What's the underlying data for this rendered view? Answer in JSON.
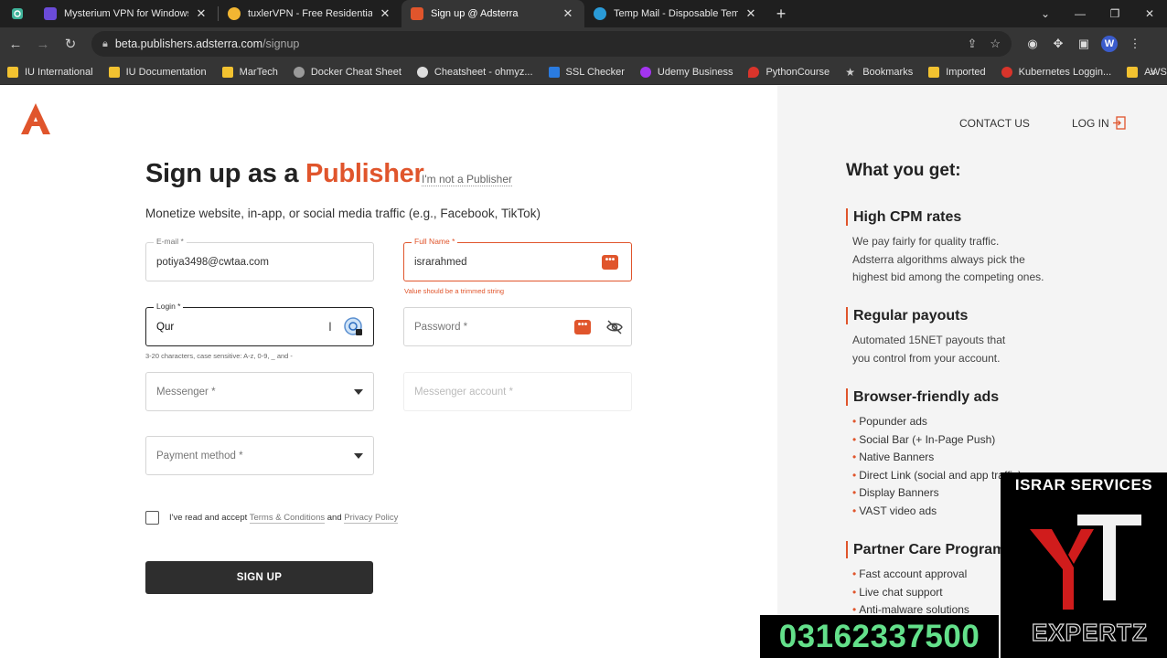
{
  "browser": {
    "tabs": [
      {
        "title": "Mysterium VPN for Windows",
        "favicon_color": "#6b4bd8",
        "active": false
      },
      {
        "title": "tuxlerVPN - Free Residential VPN",
        "favicon_color": "#f2b632",
        "active": false
      },
      {
        "title": "Sign up @ Adsterra",
        "favicon_color": "#e0552c",
        "active": true
      },
      {
        "title": "Temp Mail - Disposable Temporary",
        "favicon_color": "#2a9bd8",
        "active": false
      }
    ],
    "url_host": "beta.publishers.adsterra.com",
    "url_path": "/signup",
    "bookmarks": [
      {
        "label": "IU International",
        "icon_color": "#f2c230"
      },
      {
        "label": "IU Documentation",
        "icon_color": "#f2c230"
      },
      {
        "label": "MarTech",
        "icon_color": "#f2c230"
      },
      {
        "label": "Docker Cheat Sheet",
        "icon_color": "#9a9a9a"
      },
      {
        "label": "Cheatsheet - ohmyz...",
        "icon_color": "#dddddd"
      },
      {
        "label": "SSL Checker",
        "icon_color": "#2a7be0"
      },
      {
        "label": "Udemy Business",
        "icon_color": "#a435f0"
      },
      {
        "label": "PythonCourse",
        "icon_color": "#d9342b"
      },
      {
        "label": "Bookmarks",
        "icon_color": "#cccccc"
      },
      {
        "label": "Imported",
        "icon_color": "#f2c230"
      },
      {
        "label": "Kubernetes Loggin...",
        "icon_color": "#d9342b"
      },
      {
        "label": "AWS Resources",
        "icon_color": "#f2c230"
      }
    ]
  },
  "header": {
    "contact": "CONTACT US",
    "login": "LOG IN"
  },
  "form": {
    "title_prefix": "Sign up as a",
    "title_accent": "Publisher",
    "not_publisher": "I'm not a Publisher",
    "subtitle": "Monetize website, in-app, or social media traffic (e.g., Facebook, TikTok)",
    "email": {
      "label": "E-mail *",
      "value": "potiya3498@cwtaa.com"
    },
    "full_name": {
      "label": "Full Name *",
      "value": "israrahmed",
      "error": "Value should be a trimmed string"
    },
    "login": {
      "label": "Login *",
      "value": "Qur",
      "hint": "3-20 characters, case sensitive: A-z, 0-9, _ and -"
    },
    "password": {
      "placeholder": "Password *"
    },
    "messenger": {
      "placeholder": "Messenger *"
    },
    "messenger_account": {
      "placeholder": "Messenger account *"
    },
    "payment_method": {
      "placeholder": "Payment method *"
    },
    "terms": {
      "prefix": "I've read and accept",
      "terms_link": "Terms & Conditions",
      "and": "and",
      "privacy_link": "Privacy Policy"
    },
    "submit": "SIGN UP"
  },
  "benefits": {
    "title": "What you get:",
    "cpm": {
      "title": "High CPM rates",
      "lines": [
        "We pay fairly for quality traffic.",
        "Adsterra algorithms always pick the",
        "highest bid among the competing ones."
      ]
    },
    "payouts": {
      "title": "Regular payouts",
      "lines": [
        "Automated 15NET payouts that",
        "you control from your account."
      ]
    },
    "ads": {
      "title": "Browser-friendly ads",
      "items": [
        "Popunder ads",
        "Social Bar (+ In-Page Push)",
        "Native Banners",
        "Direct Link (social and app traffic)",
        "Display Banners",
        "VAST video ads"
      ]
    },
    "care": {
      "title": "Partner Care Program",
      "items": [
        "Fast account approval",
        "Live chat support",
        "Anti-malware solutions"
      ]
    }
  },
  "overlay": {
    "channel": "ISRAR SERVICES",
    "expertz": "EXPERTZ",
    "phone": "03162337500",
    "phone_color": "#63e08a"
  }
}
